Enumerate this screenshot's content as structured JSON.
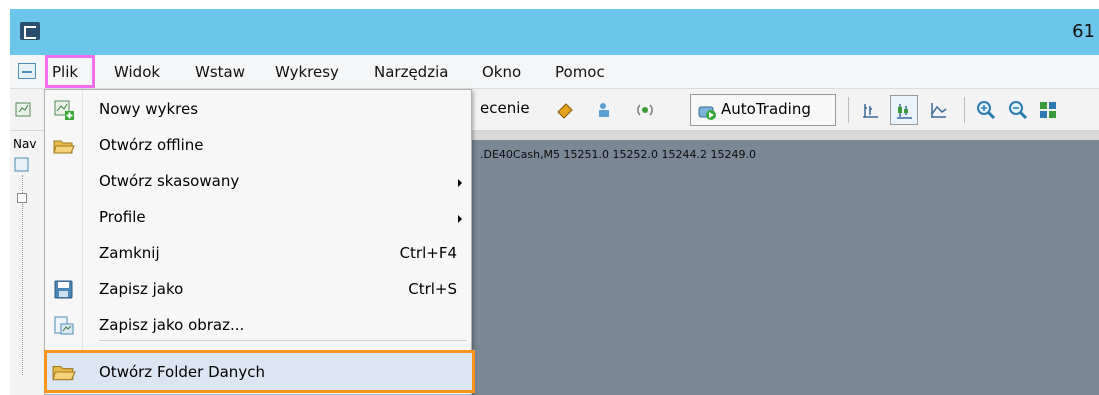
{
  "window": {
    "title_fragment": "61"
  },
  "menubar": {
    "items": [
      "Plik",
      "Widok",
      "Wstaw",
      "Wykresy",
      "Narzędzia",
      "Okno",
      "Pomoc"
    ]
  },
  "toolbar": {
    "partial_label": "ecenie",
    "autotrading_label": "AutoTrading"
  },
  "navigator": {
    "label": "Nav"
  },
  "chart": {
    "caption": ".DE40Cash,M5  15251.0 15252.0 15244.2 15249.0"
  },
  "dropdown": {
    "items": [
      {
        "label": "Nowy wykres",
        "shortcut": "",
        "submenu": false,
        "icon": "new-chart-icon"
      },
      {
        "label": "Otwórz offline",
        "shortcut": "",
        "submenu": false,
        "icon": "open-folder-icon"
      },
      {
        "label": "Otwórz skasowany",
        "shortcut": "",
        "submenu": true,
        "icon": ""
      },
      {
        "label": "Profile",
        "shortcut": "",
        "submenu": true,
        "icon": ""
      },
      {
        "label": "Zamknij",
        "shortcut": "Ctrl+F4",
        "submenu": false,
        "icon": ""
      },
      {
        "label": "Zapisz jako",
        "shortcut": "Ctrl+S",
        "submenu": false,
        "icon": "save-icon"
      },
      {
        "label": "Zapisz jako obraz...",
        "shortcut": "",
        "submenu": false,
        "icon": "save-image-icon"
      },
      {
        "label": "Otwórz Folder Danych",
        "shortcut": "",
        "submenu": false,
        "icon": "data-folder-icon"
      }
    ]
  },
  "colors": {
    "titlebar": "#6cc6ec",
    "menu_highlight_border": "#f26ef0",
    "item_highlight_border": "#f7941d",
    "chart_background": "#7a8794"
  }
}
